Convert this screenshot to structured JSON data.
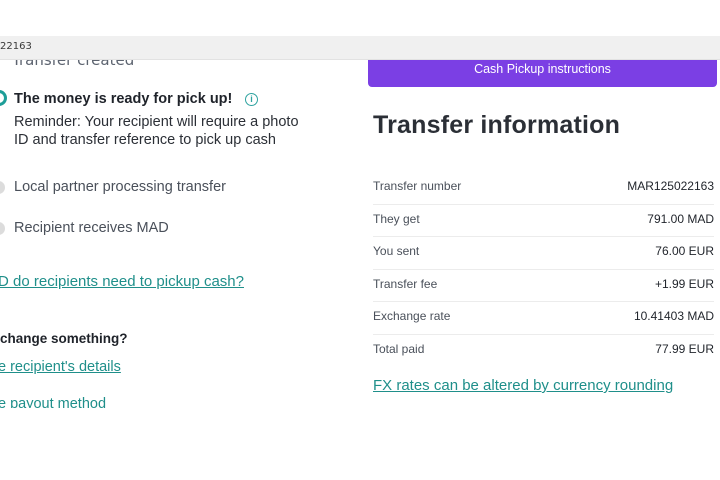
{
  "browser": {
    "url_fragment": "22163"
  },
  "steps": {
    "clipped_label": "Transfer created",
    "active": {
      "title": "The money is ready for pick up!",
      "info_icon": "info-circle-icon",
      "reminder": "Reminder: Your recipient will require a photo ID and transfer reference to pick up cash"
    },
    "pending": [
      {
        "label": "Local partner processing transfer"
      },
      {
        "label": "Recipient receives MAD"
      }
    ]
  },
  "links": {
    "help": "D do recipients need to pickup cash?",
    "change_question": "change something?",
    "recipient_details": "e recipient's details",
    "payout_method": "e payout method"
  },
  "pickup_button": {
    "label": "Cash Pickup instructions"
  },
  "transfer_info": {
    "title": "Transfer information",
    "rows": [
      {
        "label": "Transfer number",
        "value": "MAR125022163"
      },
      {
        "label": "They get",
        "value": "791.00 MAD"
      },
      {
        "label": "You sent",
        "value": "76.00 EUR"
      },
      {
        "label": "Transfer fee",
        "value": "+1.99 EUR"
      },
      {
        "label": "Exchange rate",
        "value": "10.41403 MAD"
      },
      {
        "label": "Total paid",
        "value": "77.99 EUR"
      }
    ],
    "fx_note": "FX rates can be altered by currency rounding"
  },
  "colors": {
    "accent_purple": "#7b3fe4",
    "accent_teal": "#1f8f8a",
    "text_dark": "#1f232a"
  }
}
